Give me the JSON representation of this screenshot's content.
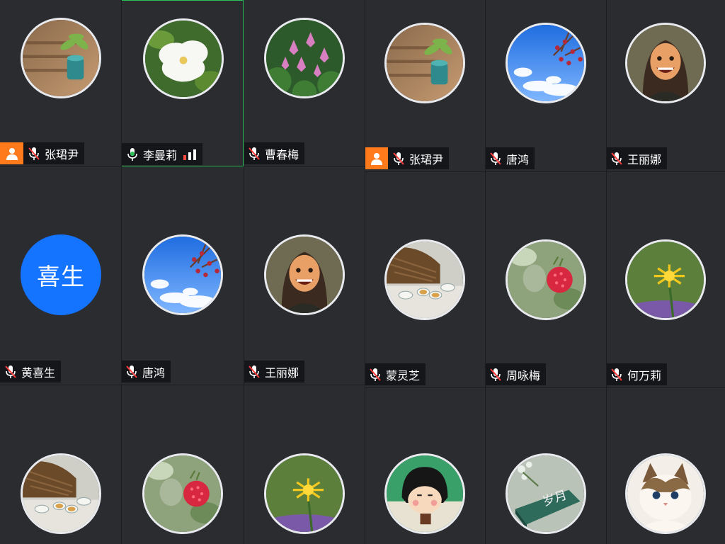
{
  "participants": [
    {
      "name": "张珺尹",
      "mic": "muted",
      "host": true,
      "avatar": "potted-plant"
    },
    {
      "name": "李曼莉",
      "mic": "active",
      "host": false,
      "avatar": "white-flower",
      "speaking": true,
      "signal": true
    },
    {
      "name": "曹春梅",
      "mic": "muted",
      "host": false,
      "avatar": "lotus"
    },
    {
      "name": "张珺尹",
      "mic": "muted",
      "host": true,
      "avatar": "potted-plant"
    },
    {
      "name": "唐鸿",
      "mic": "muted",
      "host": false,
      "avatar": "sky-branch"
    },
    {
      "name": "王丽娜",
      "mic": "muted",
      "host": false,
      "avatar": "cartoon-portrait"
    },
    {
      "name": "黄喜生",
      "mic": "muted",
      "host": false,
      "avatar_text": "喜生"
    },
    {
      "name": "唐鸿",
      "mic": "muted",
      "host": false,
      "avatar": "sky-branch"
    },
    {
      "name": "王丽娜",
      "mic": "muted",
      "host": false,
      "avatar": "cartoon-portrait"
    },
    {
      "name": "蒙灵芝",
      "mic": "muted",
      "host": false,
      "avatar": "tea-set"
    },
    {
      "name": "周咏梅",
      "mic": "muted",
      "host": false,
      "avatar": "raspberry"
    },
    {
      "name": "何万莉",
      "mic": "muted",
      "host": false,
      "avatar": "dandelion"
    },
    {
      "name": "",
      "mic": "",
      "host": false,
      "avatar": "tea-set"
    },
    {
      "name": "",
      "mic": "",
      "host": false,
      "avatar": "raspberry"
    },
    {
      "name": "",
      "mic": "",
      "host": false,
      "avatar": "dandelion"
    },
    {
      "name": "",
      "mic": "",
      "host": false,
      "avatar": "cartoon-girl"
    },
    {
      "name": "",
      "mic": "",
      "host": false,
      "avatar": "book-suiyue",
      "avatar_caption": "岁月"
    },
    {
      "name": "",
      "mic": "",
      "host": false,
      "avatar": "ragdoll-cat"
    }
  ],
  "colors": {
    "background": "#2a2c30",
    "speaking_border": "#2ec35a",
    "host_badge": "#ff7a1a",
    "text_avatar_bg": "#1473ff",
    "mic_muted": "#ff3b3b",
    "mic_active": "#2ec35a"
  },
  "icons": {
    "host": "person-icon",
    "mic_muted": "mic-muted-icon",
    "mic_active": "mic-icon",
    "signal": "signal-strength-icon"
  }
}
